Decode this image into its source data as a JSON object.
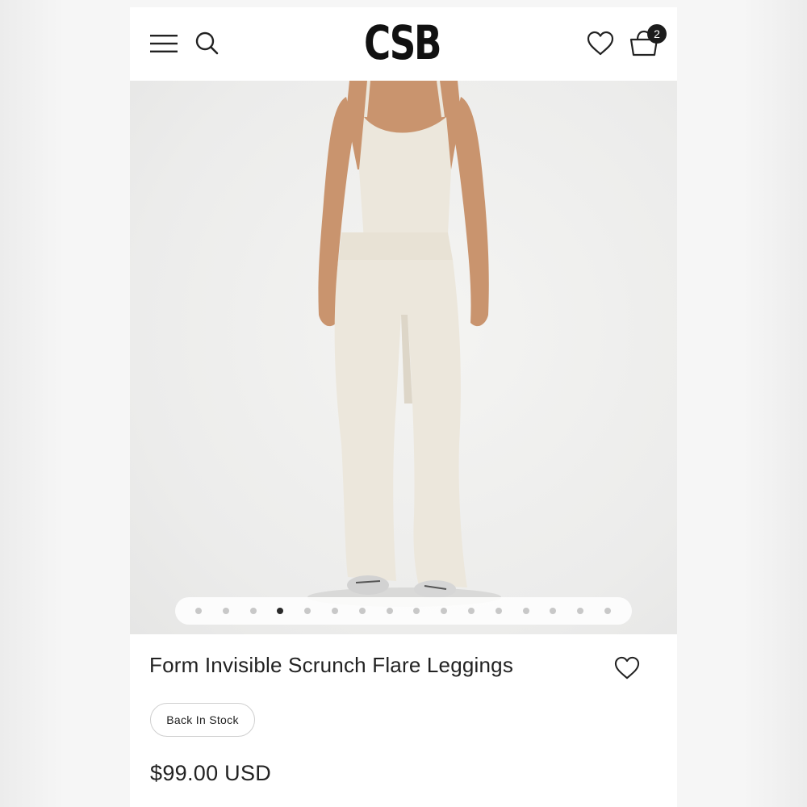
{
  "header": {
    "logo": "CSB",
    "cart_count": "2",
    "icons": [
      "menu-icon",
      "search-icon",
      "heart-icon",
      "cart-icon"
    ]
  },
  "gallery": {
    "total_images": 16,
    "active_index": 3
  },
  "product": {
    "title": "Form Invisible Scrunch Flare Leggings",
    "stock_label": "Back In Stock",
    "price": "$99.00 USD"
  },
  "colors": {
    "text": "#222222",
    "badge": "#1c1c1c",
    "background": "#ffffff",
    "garment": "#ece7dc"
  }
}
